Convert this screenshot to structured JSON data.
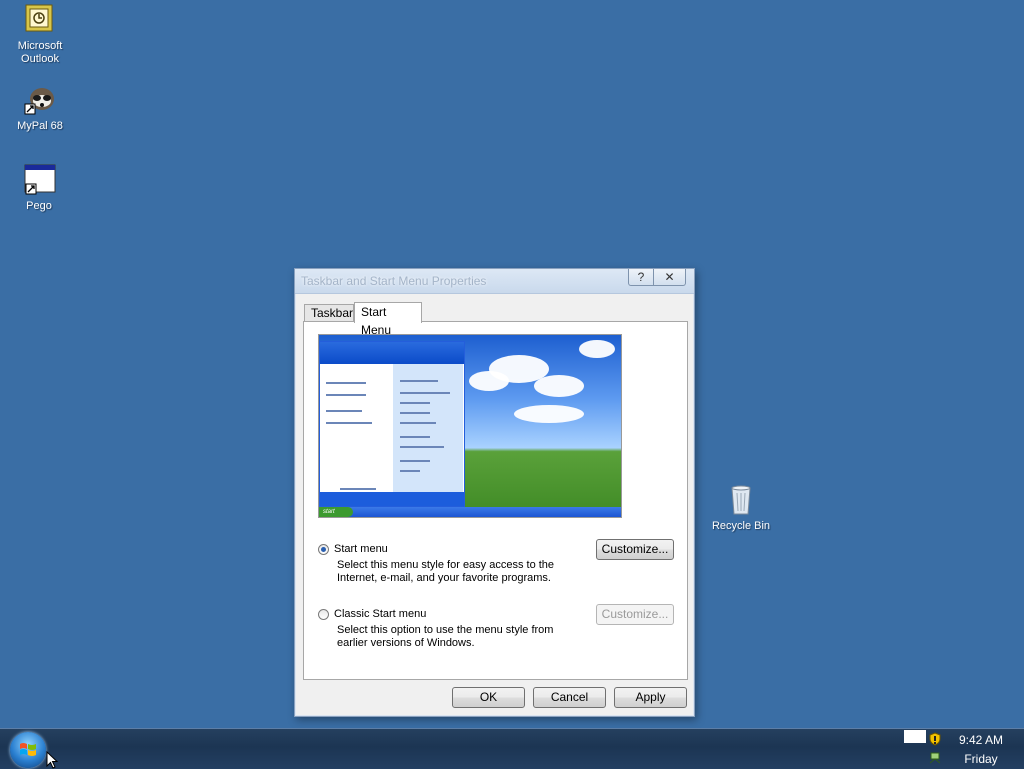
{
  "desktop": {
    "icons": [
      {
        "label": "Microsoft Outlook",
        "icon": "outlook-icon"
      },
      {
        "label": "MyPal 68",
        "icon": "raccoon-shortcut-icon"
      },
      {
        "label": "Pego",
        "icon": "window-shortcut-icon"
      },
      {
        "label": "Recycle Bin",
        "icon": "recycle-bin-icon"
      }
    ]
  },
  "dialog": {
    "title": "Taskbar and Start Menu Properties",
    "help_label": "?",
    "close_label": "✕",
    "tabs": [
      {
        "label": "Taskbar",
        "active": false
      },
      {
        "label": "Start Menu",
        "active": true
      }
    ],
    "options": [
      {
        "label": "Start menu",
        "selected": true,
        "description": "Select this menu style for easy access to the Internet, e-mail, and your favorite programs.",
        "button": "Customize...",
        "button_enabled": true
      },
      {
        "label": "Classic Start menu",
        "selected": false,
        "description": "Select this option to use the menu style from earlier versions of Windows.",
        "button": "Customize...",
        "button_enabled": false
      }
    ],
    "buttons": {
      "ok": "OK",
      "cancel": "Cancel",
      "apply": "Apply"
    }
  },
  "taskbar": {
    "time": "9:42 AM",
    "day": "Friday"
  },
  "colors": {
    "desktop": "#3a6ea5",
    "taskbar": "#1c3553",
    "dialog_bg": "#f0f0f0"
  }
}
